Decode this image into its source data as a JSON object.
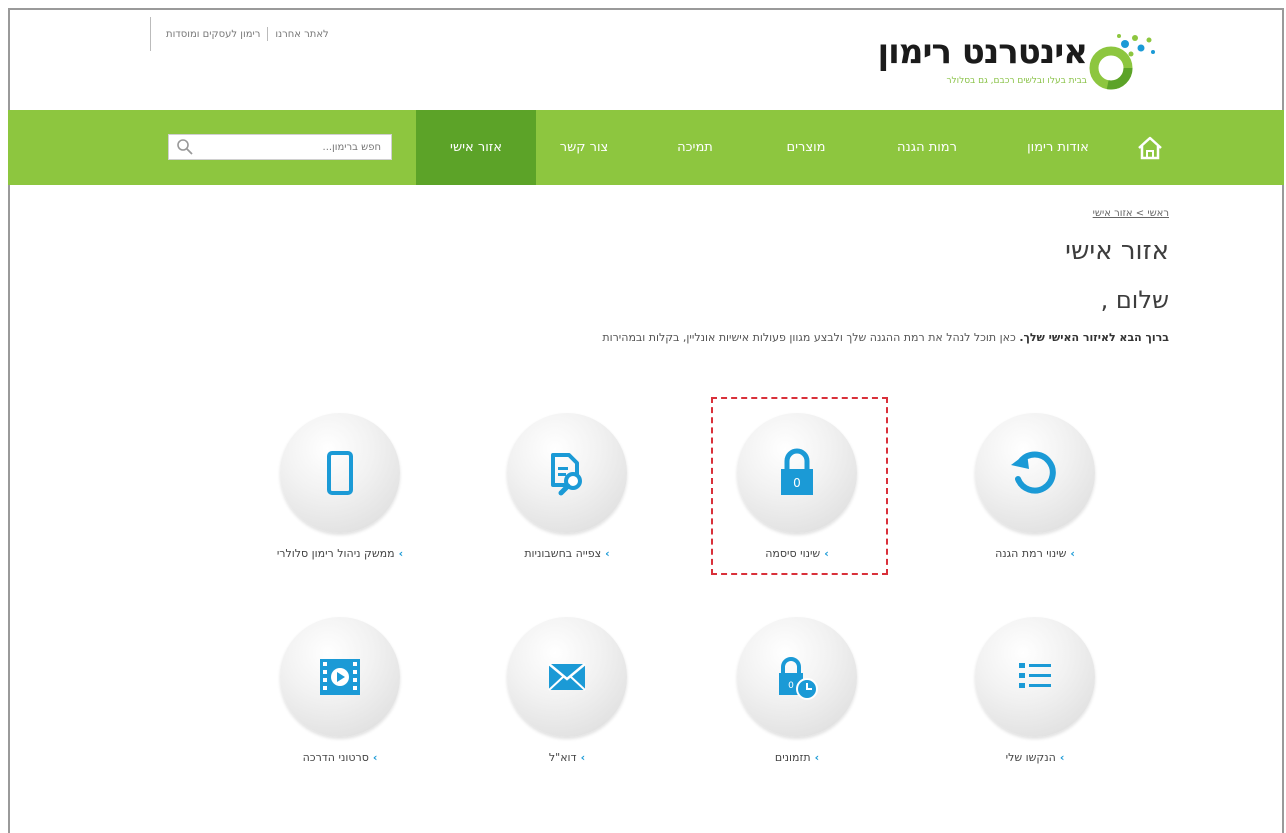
{
  "header": {
    "top_links": [
      "לאתר אחרנו",
      "רימון לעסקים ומוסדות"
    ],
    "logo_text": "אינטרנט רימון",
    "logo_tagline": "בבית בעלו ובלשים רכבם, גם בסלולר"
  },
  "nav": {
    "items": [
      {
        "label": "אודות רימון"
      },
      {
        "label": "רמות הגנה"
      },
      {
        "label": "מוצרים"
      },
      {
        "label": "תמיכה"
      },
      {
        "label": "צור קשר"
      },
      {
        "label": "אזור אישי",
        "active": true
      }
    ],
    "search_placeholder": "חפש ברימון..."
  },
  "breadcrumb": "ראשי > אזור אישי",
  "page_title": "אזור אישי",
  "greeting": "שלום ,",
  "intro": {
    "bold": "ברוך הבא לאיזור האישי שלך.",
    "text": " כאן תוכל לנהל את רמת ההגנה שלך ולבצע מגוון פעולות אישיות אונליין, בקלות ובמהירות"
  },
  "tiles": [
    {
      "label": "שינוי רמת הגנה",
      "icon": "refresh-icon"
    },
    {
      "label": "שינוי סיסמה",
      "icon": "lock-icon"
    },
    {
      "label": "צפייה בחשבוניות",
      "icon": "invoice-search-icon"
    },
    {
      "label": "ממשק ניהול רימון סלולרי",
      "icon": "mobile-phone-icon"
    },
    {
      "label": "הנקשו שלי",
      "icon": "list-icon"
    },
    {
      "label": "תזמונים",
      "icon": "lock-clock-icon"
    },
    {
      "label": "דוא\"ל",
      "icon": "envelope-icon"
    },
    {
      "label": "סרטוני הדרכה",
      "icon": "video-film-icon"
    }
  ],
  "colors": {
    "nav_green": "#8dc63f",
    "nav_active": "#5ca328",
    "icon_blue": "#1b9ad6",
    "highlight_red": "#d9303a"
  }
}
